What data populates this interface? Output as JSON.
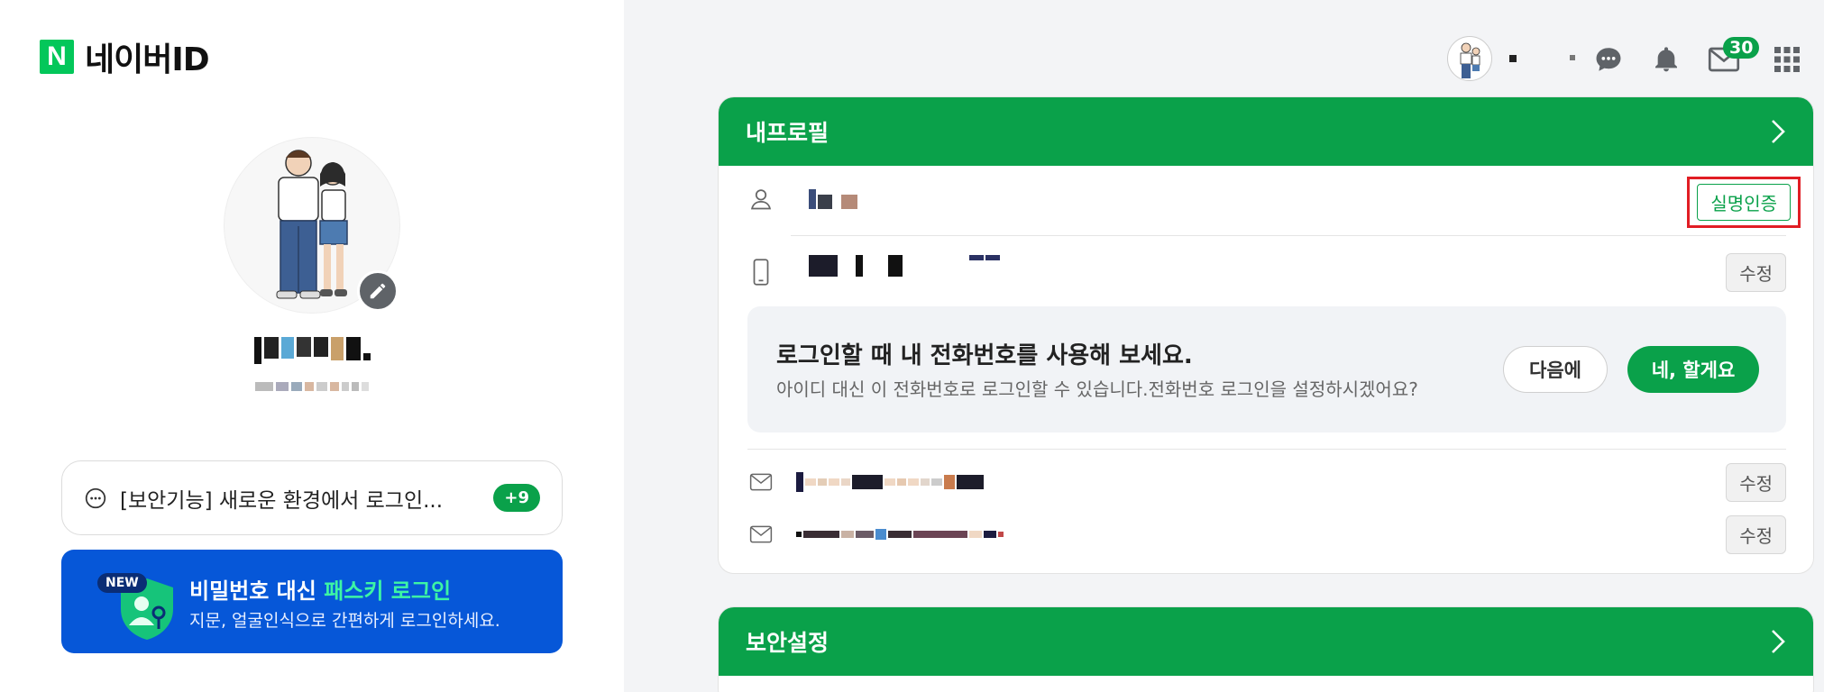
{
  "app": {
    "logo_mark": "N",
    "logo_text": "네이버ID"
  },
  "profile": {
    "name": "",
    "notice_text": "[보안기능] 새로운 환경에서 로그인...",
    "notice_badge": "+9"
  },
  "banner": {
    "new_label": "NEW",
    "title_prefix": "비밀번호 대신 ",
    "title_highlight": "패스키 로그인",
    "subtitle": "지문, 얼굴인식으로 간편하게 로그인하세요."
  },
  "topbar": {
    "icons": [
      "profile-avatar",
      "chat-icon",
      "bell-icon",
      "mail-icon",
      "apps-grid-icon"
    ],
    "mail_count": "30"
  },
  "my_profile": {
    "title": "내프로필",
    "verify_button": "실명인증",
    "edit_label": "수정",
    "suggest_title": "로그인할 때 내 전화번호를 사용해 보세요.",
    "suggest_sub": "아이디 대신 이 전화번호로 로그인할 수 있습니다.전화번호 로그인을 설정하시겠어요?",
    "later_button": "다음에",
    "yes_button": "네, 할게요"
  },
  "security": {
    "title": "보안설정"
  },
  "colors": {
    "brand_green": "#0aa14a",
    "banner_blue": "#0657d8",
    "highlight_red": "#e11d24"
  }
}
